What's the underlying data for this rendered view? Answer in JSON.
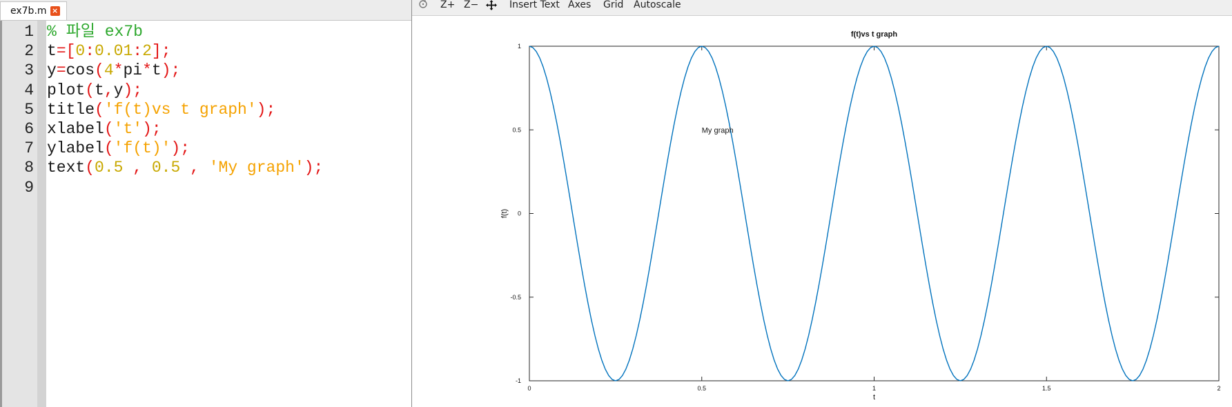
{
  "editor": {
    "tab_label": "ex7b.m",
    "tab_close_icon": "close-icon",
    "lines": [
      {
        "num": "1",
        "tokens": [
          {
            "t": "% 파일 ex7b",
            "c": "comment"
          }
        ]
      },
      {
        "num": "2",
        "tokens": [
          {
            "t": "t",
            "c": "id"
          },
          {
            "t": "=[",
            "c": "op"
          },
          {
            "t": "0",
            "c": "num"
          },
          {
            "t": ":",
            "c": "op"
          },
          {
            "t": "0.01",
            "c": "num"
          },
          {
            "t": ":",
            "c": "op"
          },
          {
            "t": "2",
            "c": "num"
          },
          {
            "t": "];",
            "c": "op"
          }
        ]
      },
      {
        "num": "3",
        "tokens": [
          {
            "t": "y",
            "c": "id"
          },
          {
            "t": "=",
            "c": "op"
          },
          {
            "t": "cos",
            "c": "id"
          },
          {
            "t": "(",
            "c": "op"
          },
          {
            "t": "4",
            "c": "num"
          },
          {
            "t": "*",
            "c": "op"
          },
          {
            "t": "pi",
            "c": "id"
          },
          {
            "t": "*",
            "c": "op"
          },
          {
            "t": "t",
            "c": "id"
          },
          {
            "t": ");",
            "c": "op"
          }
        ]
      },
      {
        "num": "4",
        "tokens": [
          {
            "t": "plot",
            "c": "id"
          },
          {
            "t": "(",
            "c": "op"
          },
          {
            "t": "t",
            "c": "id"
          },
          {
            "t": ",",
            "c": "op"
          },
          {
            "t": "y",
            "c": "id"
          },
          {
            "t": ");",
            "c": "op"
          }
        ]
      },
      {
        "num": "5",
        "tokens": [
          {
            "t": "title",
            "c": "id"
          },
          {
            "t": "(",
            "c": "op"
          },
          {
            "t": "'f(t)vs t graph'",
            "c": "str"
          },
          {
            "t": ");",
            "c": "op"
          }
        ]
      },
      {
        "num": "6",
        "tokens": [
          {
            "t": "xlabel",
            "c": "id"
          },
          {
            "t": "(",
            "c": "op"
          },
          {
            "t": "'t'",
            "c": "str"
          },
          {
            "t": ");",
            "c": "op"
          }
        ]
      },
      {
        "num": "7",
        "tokens": [
          {
            "t": "ylabel",
            "c": "id"
          },
          {
            "t": "(",
            "c": "op"
          },
          {
            "t": "'f(t)'",
            "c": "str"
          },
          {
            "t": ");",
            "c": "op"
          }
        ]
      },
      {
        "num": "8",
        "tokens": [
          {
            "t": "text",
            "c": "id"
          },
          {
            "t": "(",
            "c": "op"
          },
          {
            "t": "0.5",
            "c": "num"
          },
          {
            "t": " , ",
            "c": "op"
          },
          {
            "t": "0.5",
            "c": "num"
          },
          {
            "t": " , ",
            "c": "op"
          },
          {
            "t": "'My graph'",
            "c": "str"
          },
          {
            "t": ");",
            "c": "op"
          }
        ]
      },
      {
        "num": "9",
        "tokens": []
      }
    ]
  },
  "figure": {
    "toolbar": {
      "rotate_icon": "rotate-icon",
      "zoom_in": "Z+",
      "zoom_out": "Z−",
      "pan_icon": "pan-icon",
      "insert_text": "Insert Text",
      "axes": "Axes",
      "grid": "Grid",
      "autoscale": "Autoscale"
    }
  },
  "chart_data": {
    "type": "line",
    "title": "f(t)vs t graph",
    "xlabel": "t",
    "ylabel": "f(t)",
    "xlim": [
      0,
      2
    ],
    "ylim": [
      -1,
      1
    ],
    "xticks": [
      "0",
      "0.5",
      "1",
      "1.5",
      "2"
    ],
    "yticks": [
      "1",
      "0.5",
      "0",
      "-0.5",
      "-1"
    ],
    "grid": false,
    "function": "y = cos(4*pi*t)",
    "x_start": 0,
    "x_step": 0.01,
    "x_end": 2,
    "series": [
      {
        "color": "#1f77b4"
      }
    ],
    "annotation": {
      "text": "My graph",
      "x": 0.5,
      "y": 0.5
    },
    "colors": {
      "line": "#0072bd",
      "axes": "#262626"
    }
  }
}
